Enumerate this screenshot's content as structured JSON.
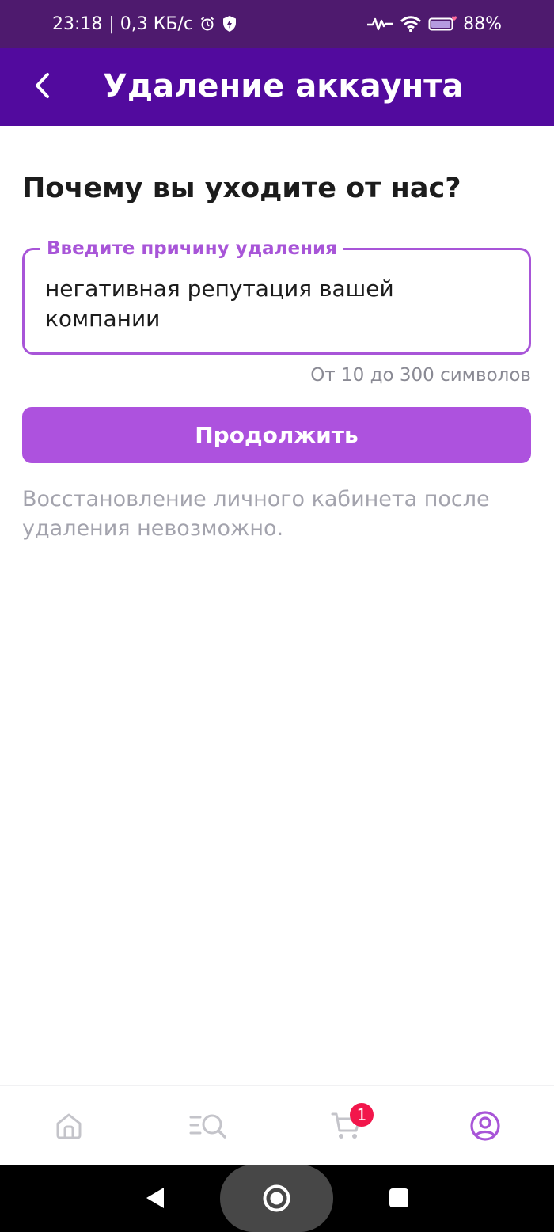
{
  "status_bar": {
    "time": "23:18",
    "network_speed": "| 0,3 КБ/с",
    "battery": "88%",
    "icons": [
      "alarm-icon",
      "shield-icon",
      "activity-icon",
      "wifi-icon",
      "battery-icon"
    ]
  },
  "app_bar": {
    "title": "Удаление аккаунта",
    "back_icon": "chevron-left-icon"
  },
  "main": {
    "question": "Почему вы уходите от нас?",
    "reason_field": {
      "label": "Введите причину удаления",
      "value": "негативная репутация вашей компании",
      "hint": "От 10 до 300 символов"
    },
    "continue_button": "Продолжить",
    "warning": "Восстановление личного кабинета после удаления невозможно."
  },
  "bottom_nav": {
    "items": [
      {
        "name": "home",
        "icon": "home-icon",
        "active": false
      },
      {
        "name": "catalog",
        "icon": "catalog-search-icon",
        "active": false
      },
      {
        "name": "cart",
        "icon": "cart-icon",
        "active": false,
        "badge": "1"
      },
      {
        "name": "profile",
        "icon": "profile-icon",
        "active": true
      }
    ]
  },
  "colors": {
    "status_bar": "#4e1a6e",
    "app_bar": "#520a9e",
    "accent": "#a855d8",
    "button": "#ad52de",
    "badge": "#f2164b",
    "inactive_icon": "#c4c4ca"
  }
}
